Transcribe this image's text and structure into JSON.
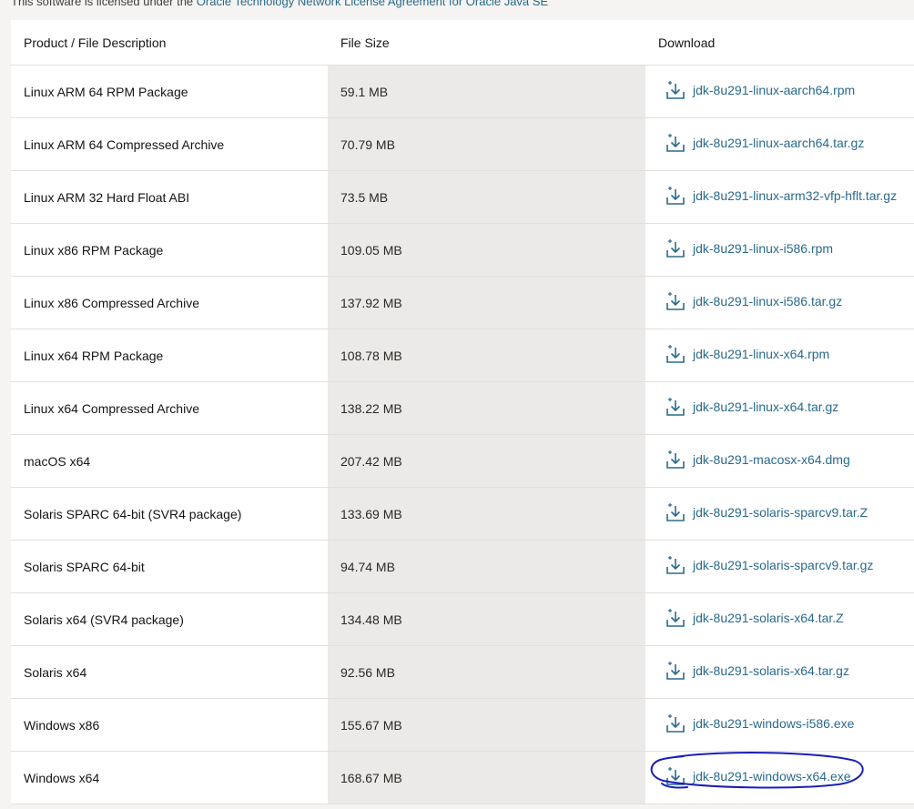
{
  "license": {
    "prefix": "This software is licensed under the ",
    "link": "Oracle Technology Network License Agreement for Oracle Java SE"
  },
  "table": {
    "headers": [
      "Product / File Description",
      "File Size",
      "Download"
    ],
    "rows": [
      {
        "desc": "Linux ARM 64 RPM Package",
        "size": "59.1 MB",
        "file": "jdk-8u291-linux-aarch64.rpm"
      },
      {
        "desc": "Linux ARM 64 Compressed Archive",
        "size": "70.79 MB",
        "file": "jdk-8u291-linux-aarch64.tar.gz"
      },
      {
        "desc": "Linux ARM 32 Hard Float ABI",
        "size": "73.5 MB",
        "file": "jdk-8u291-linux-arm32-vfp-hflt.tar.gz"
      },
      {
        "desc": "Linux x86 RPM Package",
        "size": "109.05 MB",
        "file": "jdk-8u291-linux-i586.rpm"
      },
      {
        "desc": "Linux x86 Compressed Archive",
        "size": "137.92 MB",
        "file": "jdk-8u291-linux-i586.tar.gz"
      },
      {
        "desc": "Linux x64 RPM Package",
        "size": "108.78 MB",
        "file": "jdk-8u291-linux-x64.rpm"
      },
      {
        "desc": "Linux x64 Compressed Archive",
        "size": "138.22 MB",
        "file": "jdk-8u291-linux-x64.tar.gz"
      },
      {
        "desc": "macOS x64",
        "size": "207.42 MB",
        "file": "jdk-8u291-macosx-x64.dmg"
      },
      {
        "desc": "Solaris SPARC 64-bit (SVR4 package)",
        "size": "133.69 MB",
        "file": "jdk-8u291-solaris-sparcv9.tar.Z"
      },
      {
        "desc": "Solaris SPARC 64-bit",
        "size": "94.74 MB",
        "file": "jdk-8u291-solaris-sparcv9.tar.gz"
      },
      {
        "desc": "Solaris x64 (SVR4 package)",
        "size": "134.48 MB",
        "file": "jdk-8u291-solaris-x64.tar.Z"
      },
      {
        "desc": "Solaris x64",
        "size": "92.56 MB",
        "file": "jdk-8u291-solaris-x64.tar.gz"
      },
      {
        "desc": "Windows x86",
        "size": "155.67 MB",
        "file": "jdk-8u291-windows-i586.exe"
      },
      {
        "desc": "Windows x64",
        "size": "168.67 MB",
        "file": "jdk-8u291-windows-x64.exe",
        "circled": true
      }
    ]
  },
  "icons": {
    "download": "download-icon",
    "annotation": "hand-drawn-circle-annotation"
  },
  "colors": {
    "link": "#2a6a8c",
    "size_column_bg": "#ebeae8",
    "annotation": "#1a1fb5"
  }
}
